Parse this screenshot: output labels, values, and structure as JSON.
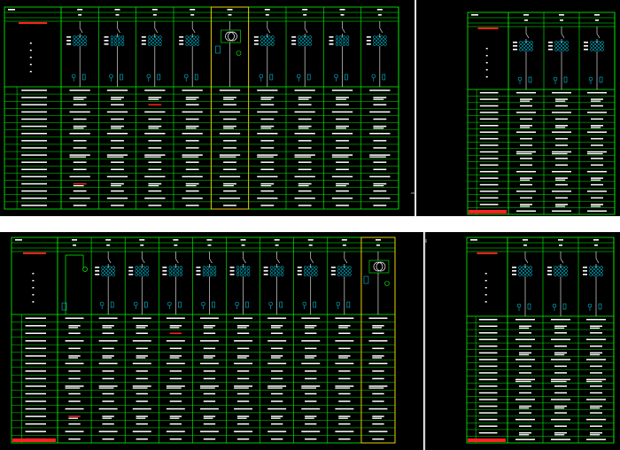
{
  "colors": {
    "background": "#000000",
    "grid": "#00ff00",
    "symbol": "#00e5ff",
    "text": "#ffffff",
    "warning": "#ff2020",
    "highlight": "#ffd700",
    "separator": "#555555"
  },
  "sheets": [
    {
      "id": "top-left",
      "columns": 9,
      "highlight_column": 4,
      "highlight_style": "device",
      "bottom_red_label": false
    },
    {
      "id": "top-right",
      "columns": 3,
      "highlight_column": -1,
      "highlight_style": "none",
      "bottom_red_label": true
    },
    {
      "id": "bottom-left",
      "columns": 10,
      "highlight_column": 9,
      "highlight_style": "device",
      "bottom_red_label": true,
      "first_column_style": "incoming"
    },
    {
      "id": "bottom-right",
      "columns": 3,
      "highlight_column": -1,
      "highlight_style": "none",
      "bottom_red_label": true
    }
  ]
}
